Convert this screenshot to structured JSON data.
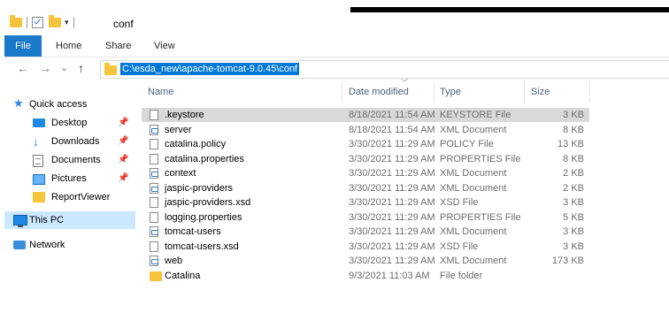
{
  "window": {
    "title": "conf",
    "qat_dropdown_glyph": "▾"
  },
  "ribbon": {
    "tabs": [
      "File",
      "Home",
      "Share",
      "View"
    ]
  },
  "address_bar": {
    "back_glyph": "←",
    "forward_glyph": "→",
    "recent_glyph": "⌄",
    "up_glyph": "↑",
    "path": "C:\\esda_new\\apache-tomcat-9.0.45\\conf"
  },
  "nav_pane": {
    "quick_access": "Quick access",
    "pin_glyph": "📌",
    "items": [
      {
        "label": "Desktop",
        "icon": "desktop-icon",
        "pinned": true
      },
      {
        "label": "Downloads",
        "icon": "downloads-icon",
        "pinned": true
      },
      {
        "label": "Documents",
        "icon": "documents-icon",
        "pinned": true
      },
      {
        "label": "Pictures",
        "icon": "pictures-icon",
        "pinned": true
      },
      {
        "label": "ReportViewer",
        "icon": "folder-icon",
        "pinned": false
      }
    ],
    "this_pc": "This PC",
    "network": "Network"
  },
  "columns": {
    "name": "Name",
    "date": "Date modified",
    "type": "Type",
    "size": "Size"
  },
  "files": [
    {
      "name": ".keystore",
      "date": "8/18/2021 11:54 AM",
      "type": "KEYSTORE File",
      "size": "3 KB",
      "icon": "file",
      "selected": true
    },
    {
      "name": "server",
      "date": "8/18/2021 11:54 AM",
      "type": "XML Document",
      "size": "8 KB",
      "icon": "xml"
    },
    {
      "name": "catalina.policy",
      "date": "3/30/2021 11:29 AM",
      "type": "POLICY File",
      "size": "13 KB",
      "icon": "file"
    },
    {
      "name": "catalina.properties",
      "date": "3/30/2021 11:29 AM",
      "type": "PROPERTIES File",
      "size": "8 KB",
      "icon": "file"
    },
    {
      "name": "context",
      "date": "3/30/2021 11:29 AM",
      "type": "XML Document",
      "size": "2 KB",
      "icon": "xml"
    },
    {
      "name": "jaspic-providers",
      "date": "3/30/2021 11:29 AM",
      "type": "XML Document",
      "size": "2 KB",
      "icon": "xml"
    },
    {
      "name": "jaspic-providers.xsd",
      "date": "3/30/2021 11:29 AM",
      "type": "XSD File",
      "size": "3 KB",
      "icon": "file"
    },
    {
      "name": "logging.properties",
      "date": "3/30/2021 11:29 AM",
      "type": "PROPERTIES File",
      "size": "5 KB",
      "icon": "file"
    },
    {
      "name": "tomcat-users",
      "date": "3/30/2021 11:29 AM",
      "type": "XML Document",
      "size": "3 KB",
      "icon": "xml"
    },
    {
      "name": "tomcat-users.xsd",
      "date": "3/30/2021 11:29 AM",
      "type": "XSD File",
      "size": "3 KB",
      "icon": "file"
    },
    {
      "name": "web",
      "date": "3/30/2021 11:29 AM",
      "type": "XML Document",
      "size": "173 KB",
      "icon": "xml"
    },
    {
      "name": "Catalina",
      "date": "9/3/2021 11:03 AM",
      "type": "File folder",
      "size": "",
      "icon": "folder"
    }
  ]
}
